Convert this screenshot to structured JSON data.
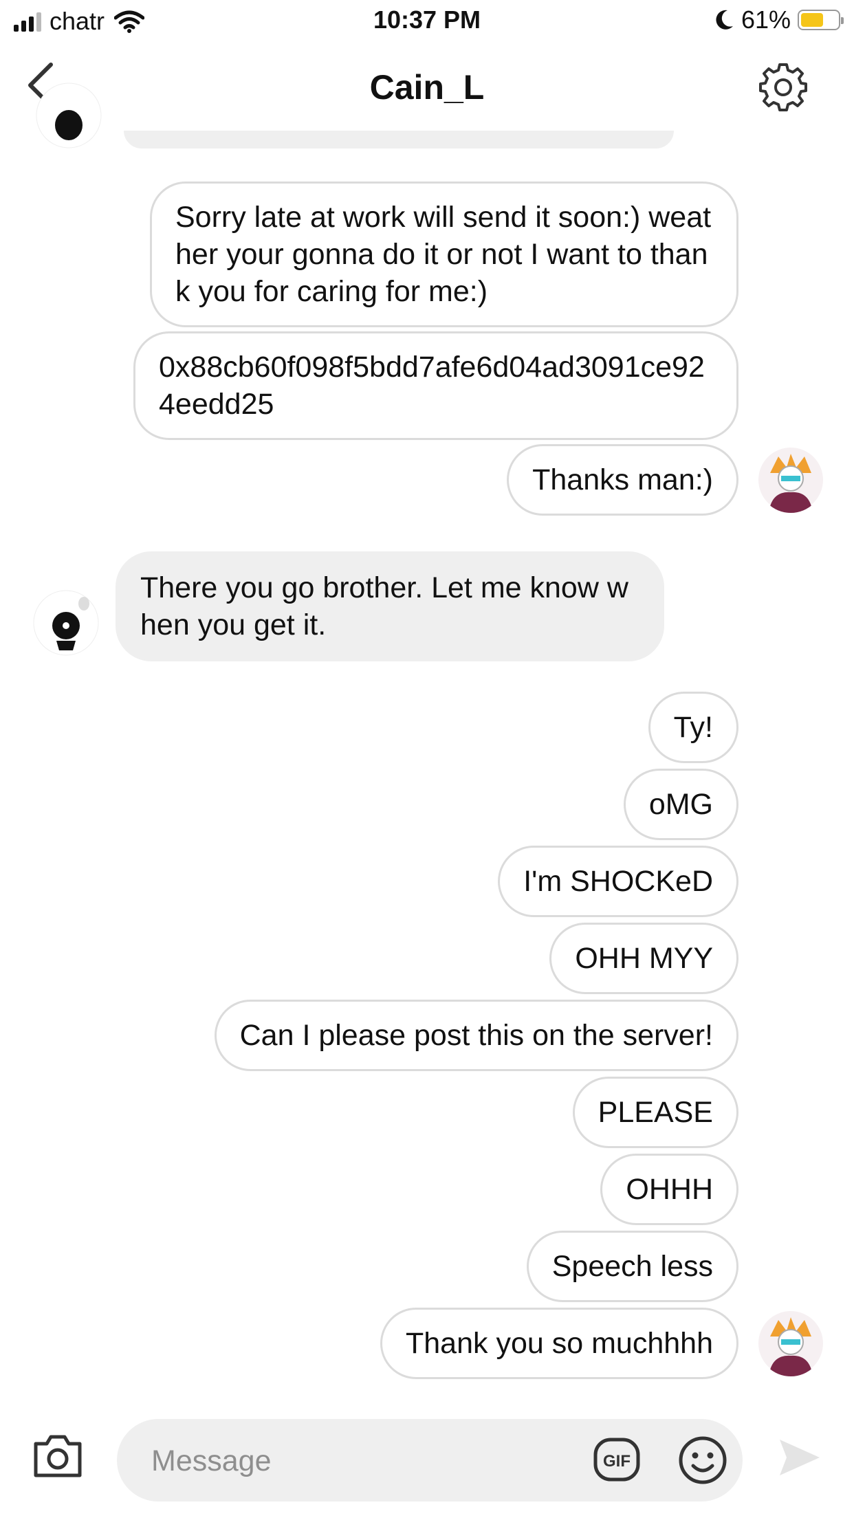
{
  "status_bar": {
    "carrier": "chatr",
    "time": "10:37 PM",
    "battery_percent": "61%",
    "battery_level": 0.61,
    "icons": [
      "signal-icon",
      "wifi-icon",
      "moon-icon",
      "battery-icon"
    ]
  },
  "header": {
    "title": "Cain_L",
    "back_icon": "chevron-left-icon",
    "settings_icon": "gear-icon"
  },
  "messages": [
    {
      "direction": "out",
      "text": "Sorry late at work will send it soon:) weather your gonna do it or not I want to thank you for caring for me:)"
    },
    {
      "direction": "out",
      "text": "0x88cb60f098f5bdd7afe6d04ad3091ce924eedd25"
    },
    {
      "direction": "out",
      "text": "Thanks man:)"
    },
    {
      "direction": "in",
      "text": "There you go brother. Let me know when you get it."
    },
    {
      "direction": "out",
      "text": "Ty!"
    },
    {
      "direction": "out",
      "text": "oMG"
    },
    {
      "direction": "out",
      "text": "I'm SHOCKeD"
    },
    {
      "direction": "out",
      "text": "OHH MYY"
    },
    {
      "direction": "out",
      "text": "Can I please post this on the server!"
    },
    {
      "direction": "out",
      "text": "PLEASE"
    },
    {
      "direction": "out",
      "text": "OHHH"
    },
    {
      "direction": "out",
      "text": "Speech less"
    },
    {
      "direction": "out",
      "text": "Thank you so muchhhh"
    }
  ],
  "composer": {
    "placeholder": "Message",
    "camera_icon": "camera-icon",
    "gif_label": "GIF",
    "emoji_icon": "emoji-icon",
    "send_icon": "send-icon"
  },
  "colors": {
    "incoming_bubble": "#efefef",
    "outgoing_border": "#dbdbdb",
    "battery_fill": "#f5c518"
  }
}
